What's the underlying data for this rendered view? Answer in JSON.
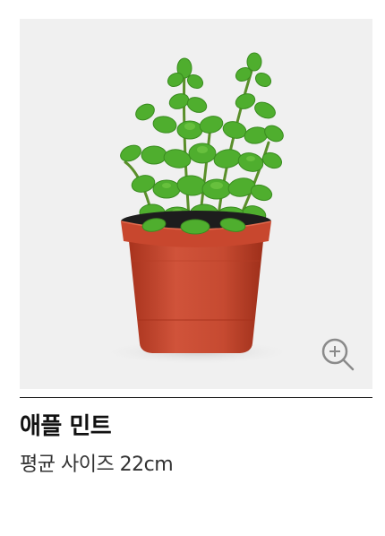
{
  "product": {
    "name": "애플 민트",
    "size_text": "평균 사이즈 22cm",
    "image": {
      "subject": "apple mint plant in red plastic pot",
      "icon": "zoom-in-icon"
    }
  },
  "colors": {
    "image_background": "#f0f0f0",
    "pot": "#c8472e",
    "leaf": "#4caf2f",
    "divider": "#222222"
  }
}
